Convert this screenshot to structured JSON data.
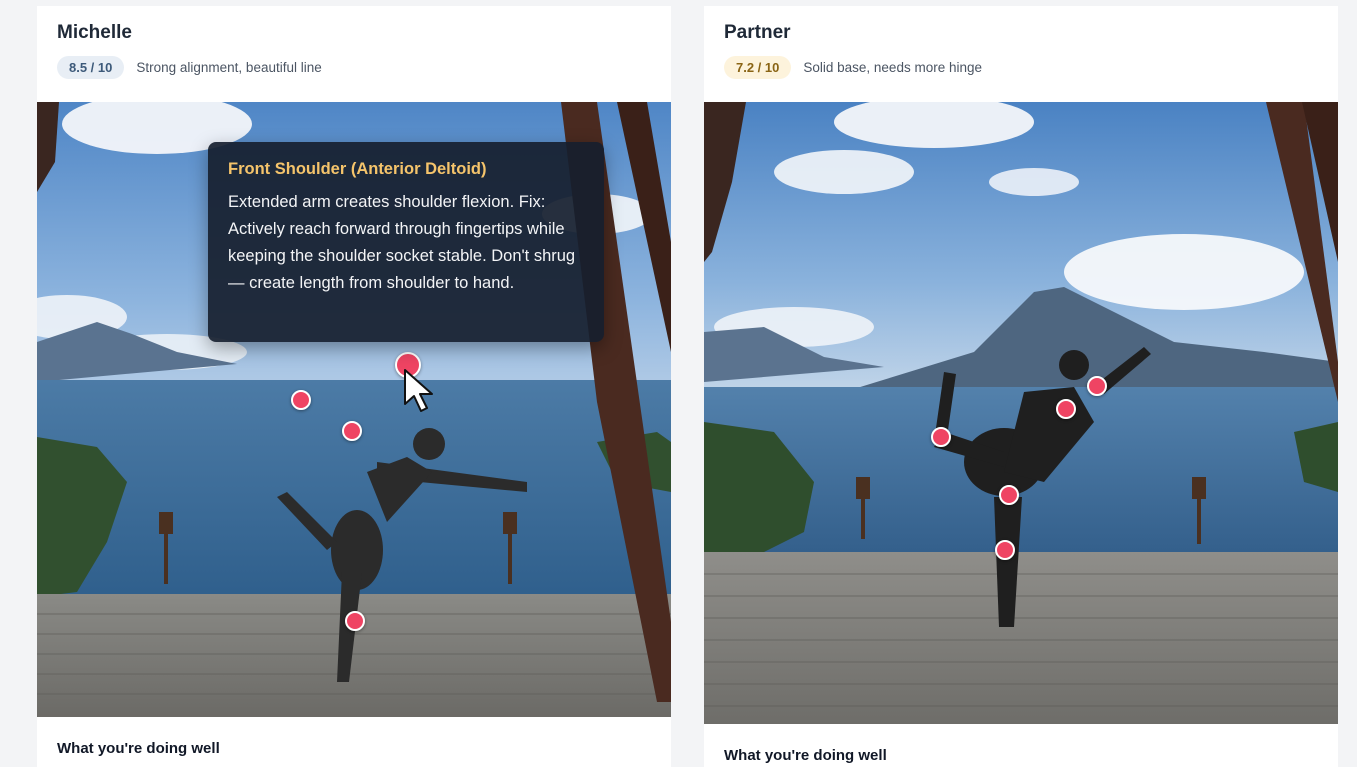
{
  "cards": [
    {
      "name": "Michelle",
      "score": "8.5 / 10",
      "score_bg": "#e8eef5",
      "score_fg": "#3d5a7a",
      "note": "Strong alignment, beautiful line",
      "section_heading": "What you're doing well",
      "tooltip": {
        "title": "Front Shoulder (Anterior Deltoid)",
        "body": "Extended arm creates shoulder flexion. Fix: Actively reach forward through fingertips while keeping the shoulder socket stable. Don't shrug — create length from shoulder to hand."
      }
    },
    {
      "name": "Partner",
      "score": "7.2 / 10",
      "score_bg": "#fdf3dc",
      "score_fg": "#8a6414",
      "note": "Solid base, needs more hinge",
      "section_heading": "What you're doing well"
    }
  ],
  "colors": {
    "hotspot": "#ef4463",
    "tooltip_title": "#f5c46b",
    "tooltip_bg": "#161e2e"
  }
}
